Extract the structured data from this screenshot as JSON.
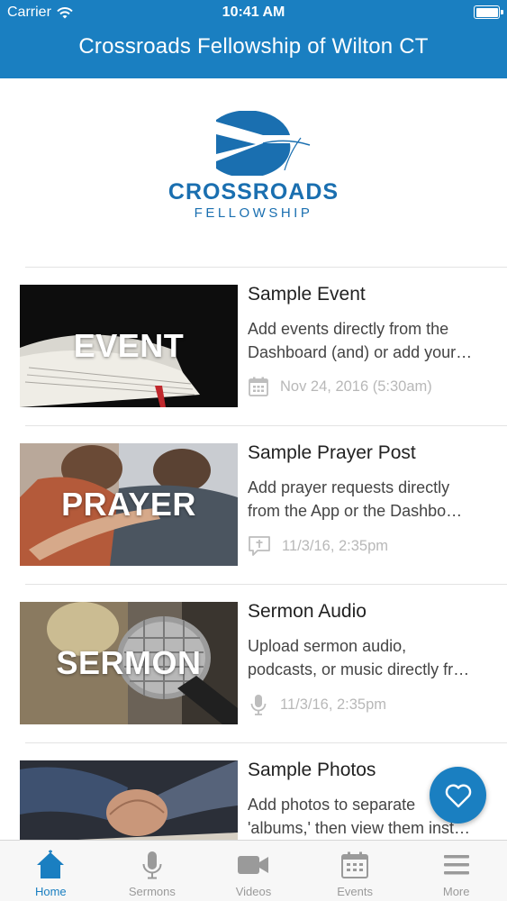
{
  "status_bar": {
    "carrier": "Carrier",
    "time": "10:41 AM"
  },
  "nav": {
    "title": "Crossroads Fellowship of Wilton CT"
  },
  "logo": {
    "name": "CROSSROADS",
    "subtitle": "FELLOWSHIP"
  },
  "feed": [
    {
      "label": "EVENT",
      "title": "Sample Event",
      "desc_lines": [
        "Add events directly from the",
        "Dashboard (and) or add your…"
      ],
      "meta": "Nov 24, 2016 (5:30am)",
      "meta_icon": "calendar-icon"
    },
    {
      "label": "PRAYER",
      "title": "Sample Prayer Post",
      "desc_lines": [
        "Add prayer requests directly",
        "from the App or the Dashbo…"
      ],
      "meta": "11/3/16, 2:35pm",
      "meta_icon": "prayer-icon"
    },
    {
      "label": "SERMON",
      "title": "Sermon Audio",
      "desc_lines": [
        "Upload sermon audio,",
        "podcasts, or music directly fr…"
      ],
      "meta": "11/3/16, 2:35pm",
      "meta_icon": "microphone-icon"
    },
    {
      "label": "",
      "title": "Sample Photos",
      "desc_lines": [
        "Add photos to separate",
        "'albums,' then view them inst…"
      ],
      "meta": "",
      "meta_icon": ""
    }
  ],
  "fab": {
    "icon": "heart-icon"
  },
  "tabs": [
    {
      "label": "Home",
      "icon": "home-icon",
      "active": true
    },
    {
      "label": "Sermons",
      "icon": "microphone-icon",
      "active": false
    },
    {
      "label": "Videos",
      "icon": "video-camera-icon",
      "active": false
    },
    {
      "label": "Events",
      "icon": "calendar-icon",
      "active": false
    },
    {
      "label": "More",
      "icon": "menu-icon",
      "active": false
    }
  ],
  "colors": {
    "brand": "#1a7fc1",
    "logo": "#1a6fb0",
    "meta_text": "#b8b8b8",
    "inactive_tab": "#9a9a9a"
  }
}
